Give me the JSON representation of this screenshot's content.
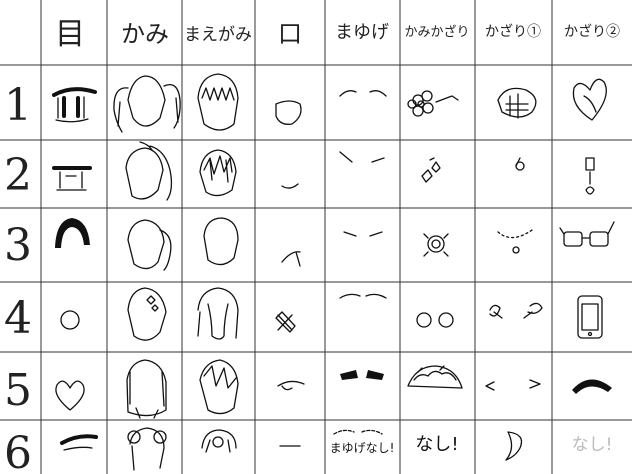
{
  "headers": [
    "目",
    "かみ",
    "まえがみ",
    "口",
    "まゆげ",
    "かみかざり",
    "かざり①",
    "かざり②"
  ],
  "row_numbers": [
    "1",
    "2",
    "3",
    "4",
    "5",
    "6"
  ],
  "cells": {
    "mayuge_none": "まゆげなし!",
    "kamikazari_none": "なし!",
    "kazari2_none": "なし!"
  }
}
